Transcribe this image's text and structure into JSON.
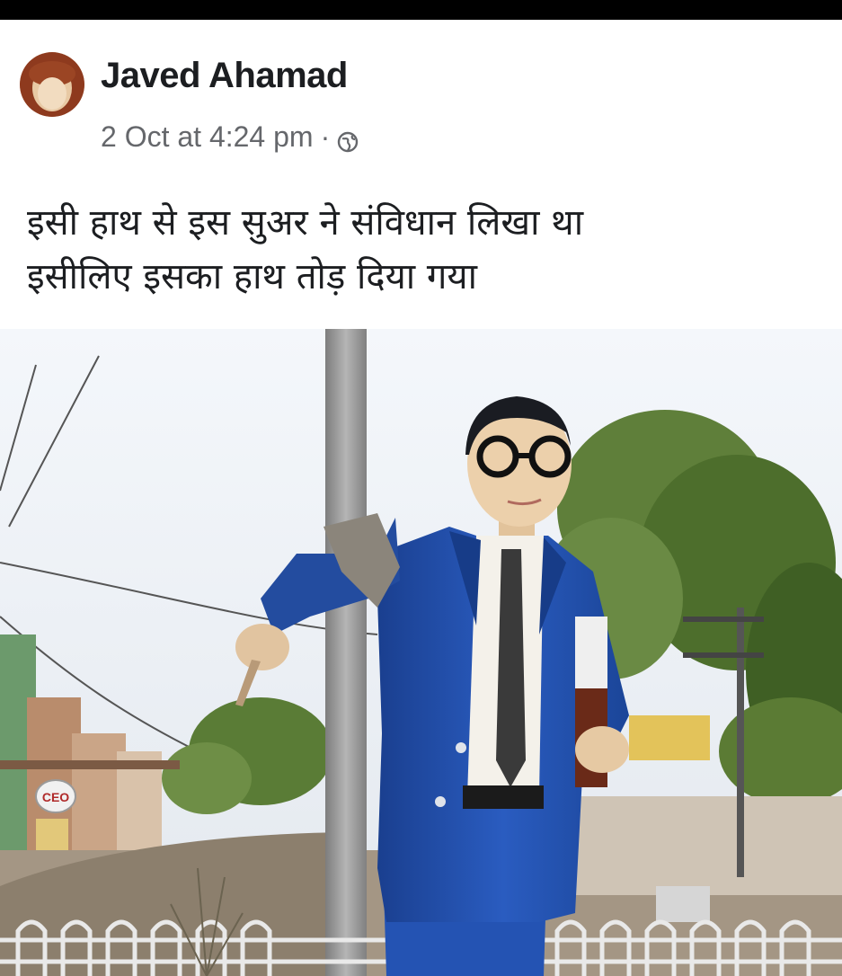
{
  "post": {
    "author_name": "Javed Ahamad",
    "timestamp": "2 Oct at 4:24 pm",
    "separator": "·",
    "privacy_icon": "globe-icon",
    "text_lines": [
      "इसी हाथ से इस सुअर ने संविधान लिखा था",
      "इसीलिए इसका हाथ तोड़ दिया गया"
    ],
    "photo": {
      "sign_text": "CEO"
    }
  },
  "colors": {
    "name": "#1c1e21",
    "meta": "#65676b",
    "suit": "#1f4ea8",
    "sky": "#eef3f8"
  }
}
